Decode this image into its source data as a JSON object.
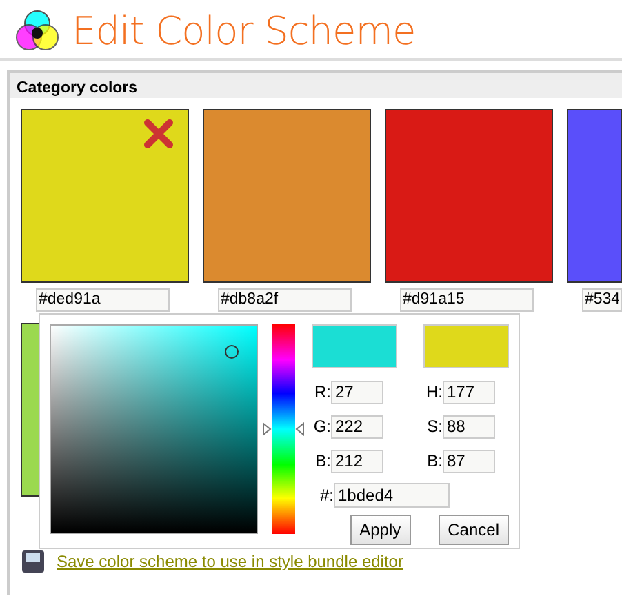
{
  "header": {
    "title": "Edit Color Scheme"
  },
  "panel": {
    "title": "Category colors",
    "swatches": [
      {
        "color": "#dfd91b",
        "value": "#ded91a",
        "removable": true
      },
      {
        "color": "#db8a2f",
        "value": "#db8a2f"
      },
      {
        "color": "#d91a15",
        "value": "#d91a15"
      },
      {
        "color": "#5a4ffa",
        "value": "#534"
      },
      {
        "color": "#9bd94f"
      }
    ],
    "save_link": "Save color scheme to use in style bundle editor"
  },
  "picker": {
    "previews": [
      {
        "color": "#1bded4"
      },
      {
        "color": "#dfd91b"
      }
    ],
    "hue_slider": {
      "level": 0.5
    },
    "fields_left": [
      {
        "label": "R:",
        "value": "27"
      },
      {
        "label": "G:",
        "value": "222"
      },
      {
        "label": "B:",
        "value": "212"
      }
    ],
    "fields_right": [
      {
        "label": "H:",
        "value": "177"
      },
      {
        "label": "S:",
        "value": "88"
      },
      {
        "label": "B:",
        "value": "87"
      }
    ],
    "hex": {
      "label": "#:",
      "value": "1bded4"
    },
    "buttons": [
      "Apply",
      "Cancel"
    ]
  }
}
